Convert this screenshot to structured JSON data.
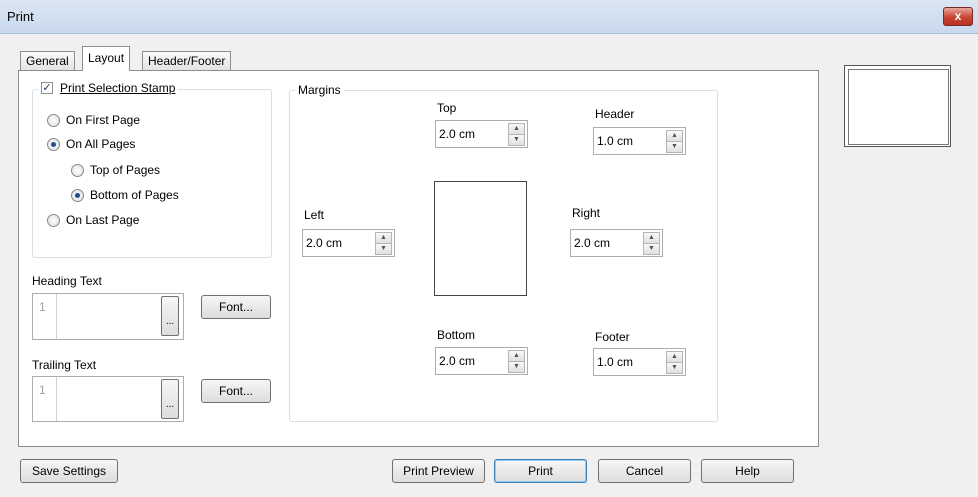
{
  "window": {
    "title": "Print",
    "close_label": "x"
  },
  "tabs": [
    {
      "label": "General",
      "active": false
    },
    {
      "label": "Layout",
      "active": true
    },
    {
      "label": "Header/Footer",
      "active": false
    }
  ],
  "stamp": {
    "checkbox_label": "Print Selection Stamp",
    "checked": true,
    "options": {
      "on_first_page": "On First Page",
      "on_all_pages": "On All Pages",
      "top_of_pages": "Top of Pages",
      "bottom_of_pages": "Bottom of Pages",
      "on_last_page": "On Last Page"
    },
    "selected": "on_all_pages",
    "selected_position": "bottom_of_pages"
  },
  "heading": {
    "label": "Heading Text",
    "line_number": "1",
    "browse_label": "...",
    "font_button": "Font..."
  },
  "trailing": {
    "label": "Trailing Text",
    "line_number": "1",
    "browse_label": "...",
    "font_button": "Font..."
  },
  "margins": {
    "group_label": "Margins",
    "top": {
      "label": "Top",
      "value": "2.0 cm"
    },
    "header": {
      "label": "Header",
      "value": "1.0 cm"
    },
    "left": {
      "label": "Left",
      "value": "2.0 cm"
    },
    "right": {
      "label": "Right",
      "value": "2.0 cm"
    },
    "bottom": {
      "label": "Bottom",
      "value": "2.0 cm"
    },
    "footer": {
      "label": "Footer",
      "value": "1.0 cm"
    },
    "spin_up": "▲",
    "spin_down": "▼"
  },
  "buttons": {
    "save_settings": "Save Settings",
    "print_preview": "Print Preview",
    "print": "Print",
    "cancel": "Cancel",
    "help": "Help"
  },
  "colors": {
    "titlebar": "#c9d9ee",
    "close": "#c74533",
    "panel": "#ffffff",
    "face": "#f0f0f0"
  }
}
